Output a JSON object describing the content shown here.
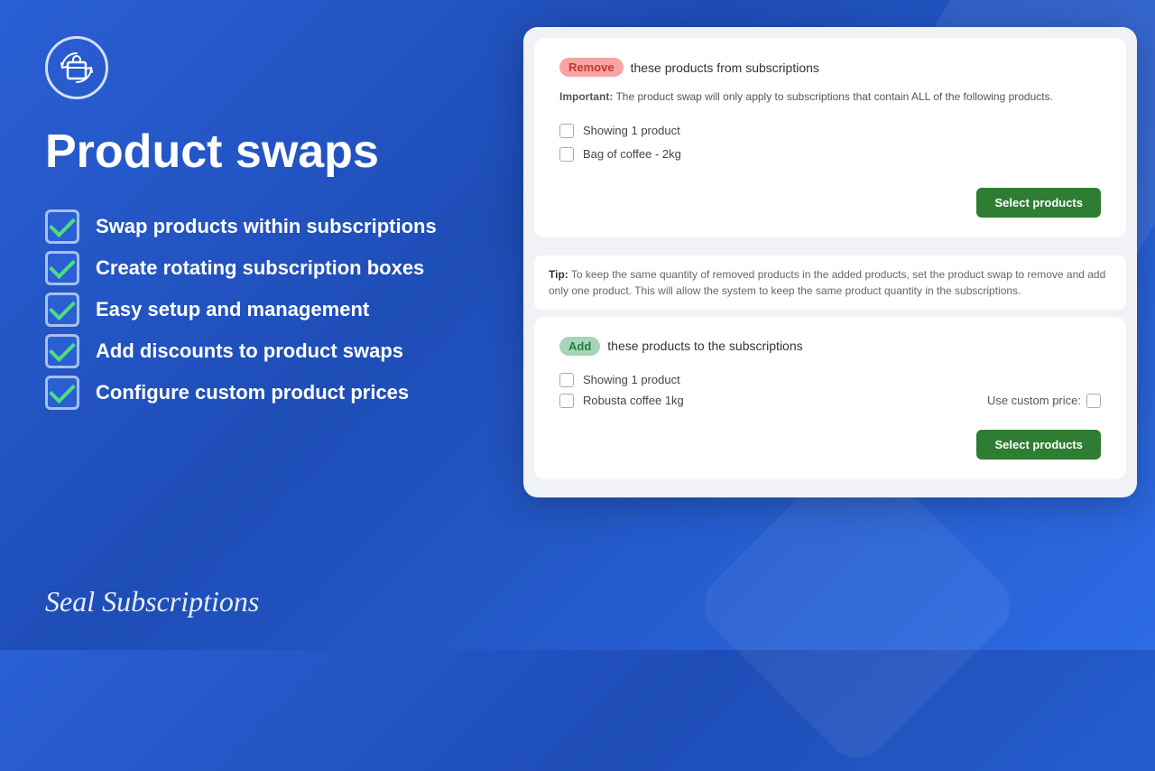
{
  "background": {
    "color1": "#2a5fd4",
    "color2": "#1e4db7"
  },
  "left": {
    "title": "Product swaps",
    "features": [
      {
        "id": "feature-1",
        "text": "Swap products within subscriptions"
      },
      {
        "id": "feature-2",
        "text": "Create rotating subscription boxes"
      },
      {
        "id": "feature-3",
        "text": "Easy setup and management"
      },
      {
        "id": "feature-4",
        "text": "Add discounts to product swaps"
      },
      {
        "id": "feature-5",
        "text": "Configure custom product prices"
      }
    ],
    "brand": "Seal Subscriptions"
  },
  "card": {
    "remove_section": {
      "badge": "Remove",
      "title_text": "these products from subscriptions",
      "important_label": "Important:",
      "important_text": " The product swap will only apply to subscriptions that contain ALL of the following products.",
      "products": [
        {
          "label": "Showing 1 product"
        },
        {
          "label": "Bag of coffee - 2kg"
        }
      ],
      "select_btn": "Select products",
      "tip_label": "Tip:",
      "tip_text": " To keep the same quantity of removed products in the added products, set the product swap to remove and add only one product. This will allow the system to keep the same product quantity in the subscriptions."
    },
    "add_section": {
      "badge": "Add",
      "title_text": "these products to the subscriptions",
      "products": [
        {
          "label": "Showing 1 product"
        },
        {
          "label": "Robusta coffee 1kg"
        }
      ],
      "custom_price_label": "Use custom price:",
      "select_btn": "Select products"
    }
  }
}
